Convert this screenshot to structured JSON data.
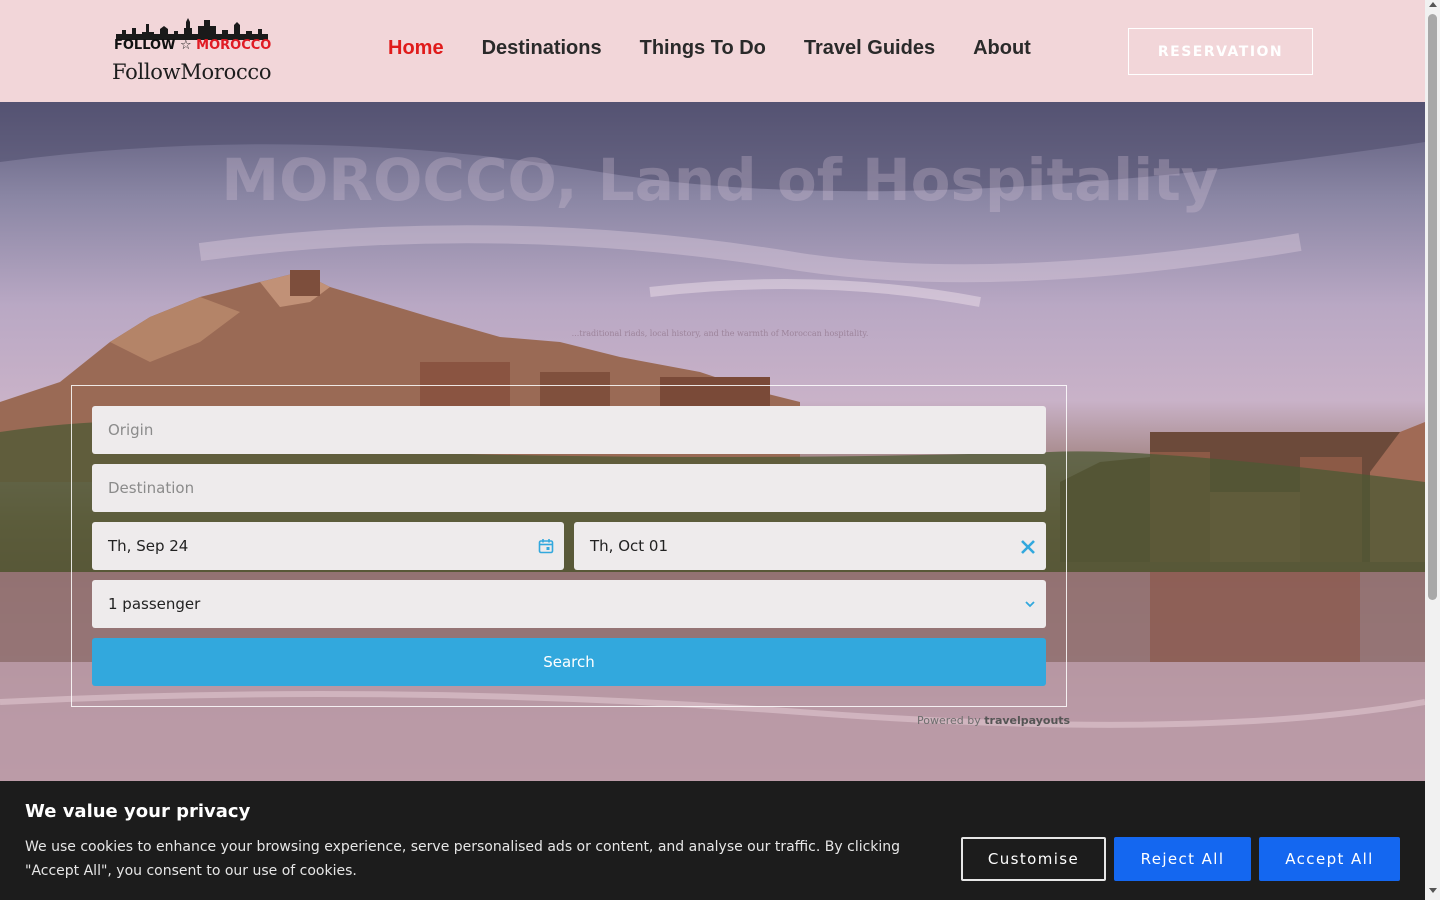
{
  "header": {
    "logo_badge_left": "FOLLOW",
    "logo_badge_star": "☆",
    "logo_badge_right": "MOROCCO",
    "logo_name": "FollowMorocco",
    "nav": [
      "Home",
      "Destinations",
      "Things To Do",
      "Travel Guides",
      "About"
    ],
    "active_nav": "Home",
    "reservation_label": "RESERVATION"
  },
  "hero": {
    "title": "MOROCCO, Land of Hospitality",
    "subtitle": "...traditional riads, local history, and the warmth of Moroccan hospitality."
  },
  "search": {
    "origin_placeholder": "Origin",
    "destination_placeholder": "Destination",
    "depart_date": "Th, Sep 24",
    "return_date": "Th, Oct 01",
    "passengers": "1 passenger",
    "search_label": "Search",
    "powered_by": "Powered by",
    "powered_brand": "travelpayouts"
  },
  "cookie": {
    "title": "We value your privacy",
    "text": "We use cookies to enhance your browsing experience, serve personalised ads or content, and analyse our traffic. By clicking \"Accept All\", you consent to our use of cookies.",
    "customise_label": "Customise",
    "reject_label": "Reject All",
    "accept_label": "Accept All"
  },
  "colors": {
    "header_bg": "#f2d6d9",
    "nav_active": "#e01b1b",
    "search_button": "#32a8dd",
    "cookie_bg": "#1c1c1c",
    "cookie_button": "#1467f0"
  },
  "icons": [
    "calendar-icon",
    "close-icon",
    "chevron-down-icon"
  ]
}
